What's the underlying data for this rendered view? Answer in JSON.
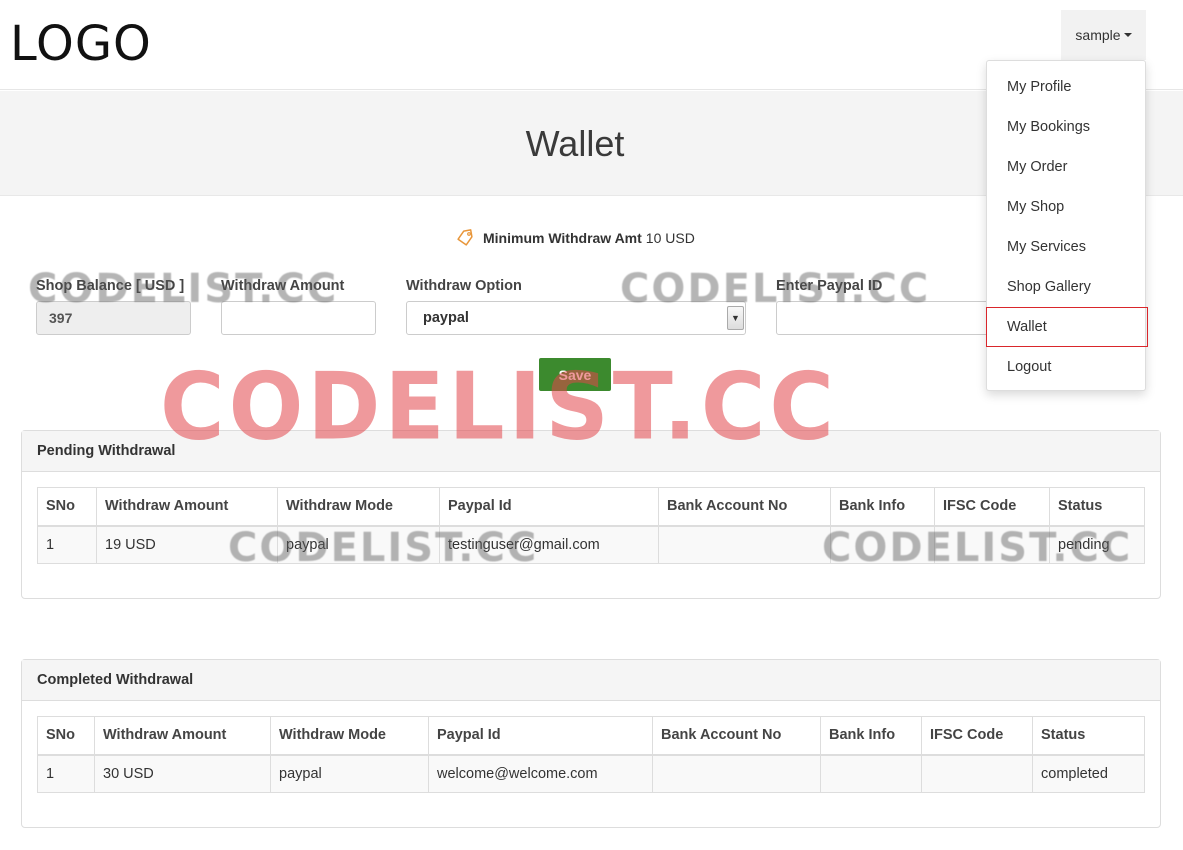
{
  "header": {
    "logo": "LOGO",
    "user_menu_label": "sample"
  },
  "page_title": "Wallet",
  "min_withdraw": {
    "label": "Minimum Withdraw Amt",
    "amount": "10 USD"
  },
  "form": {
    "shop_balance_label": "Shop Balance [ USD ]",
    "shop_balance_value": "397",
    "withdraw_amount_label": "Withdraw Amount",
    "withdraw_amount_value": "",
    "withdraw_option_label": "Withdraw Option",
    "withdraw_option_value": "paypal",
    "paypal_id_label": "Enter Paypal ID",
    "paypal_id_value": "",
    "save_label": "Save"
  },
  "pending": {
    "title": "Pending Withdrawal",
    "columns": [
      "SNo",
      "Withdraw Amount",
      "Withdraw Mode",
      "Paypal Id",
      "Bank Account No",
      "Bank Info",
      "IFSC Code",
      "Status"
    ],
    "rows": [
      [
        "1",
        "19 USD",
        "paypal",
        "testinguser@gmail.com",
        "",
        "",
        "",
        "pending"
      ]
    ]
  },
  "completed": {
    "title": "Completed Withdrawal",
    "columns": [
      "SNo",
      "Withdraw Amount",
      "Withdraw Mode",
      "Paypal Id",
      "Bank Account No",
      "Bank Info",
      "IFSC Code",
      "Status"
    ],
    "rows": [
      [
        "1",
        "30 USD",
        "paypal",
        "welcome@welcome.com",
        "",
        "",
        "",
        "completed"
      ]
    ]
  },
  "user_dropdown": {
    "items": [
      {
        "label": "My Profile",
        "active": false
      },
      {
        "label": "My Bookings",
        "active": false
      },
      {
        "label": "My Order",
        "active": false
      },
      {
        "label": "My Shop",
        "active": false
      },
      {
        "label": "My Services",
        "active": false
      },
      {
        "label": "Shop Gallery",
        "active": false
      },
      {
        "label": "Wallet",
        "active": true
      },
      {
        "label": "Logout",
        "active": false
      }
    ]
  },
  "watermark": "CODELIST.CC",
  "colors": {
    "save_button": "#3c8a2e",
    "active_outline": "#d9262b",
    "tag_icon": "#e8963a"
  }
}
